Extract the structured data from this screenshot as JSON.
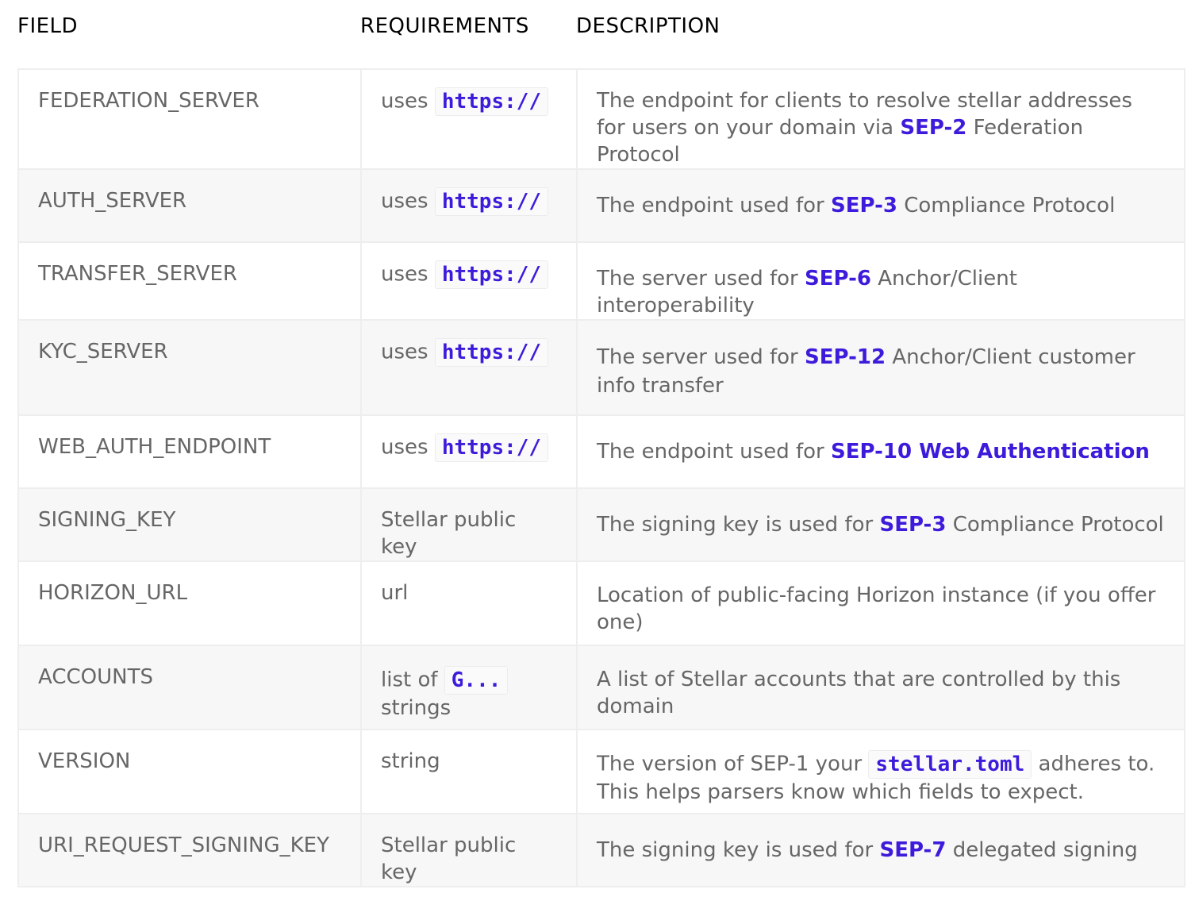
{
  "header": {
    "field": "FIELD",
    "requirements": "REQUIREMENTS",
    "description": "DESCRIPTION"
  },
  "rows": [
    {
      "field": "FEDERATION_SERVER",
      "req_prefix": "uses",
      "req_code": "https://",
      "desc_before": "The endpoint for clients to resolve stellar addresses for users on your domain via ",
      "desc_link": "SEP-2",
      "desc_after": " Federation Protocol"
    },
    {
      "field": "AUTH_SERVER",
      "req_prefix": "uses",
      "req_code": "https://",
      "desc_before": "The endpoint used for ",
      "desc_link": "SEP-3",
      "desc_after": " Compliance Protocol"
    },
    {
      "field": "TRANSFER_SERVER",
      "req_prefix": "uses",
      "req_code": "https://",
      "desc_before": "The server used for ",
      "desc_link": "SEP-6",
      "desc_after": " Anchor/Client interoperability"
    },
    {
      "field": "KYC_SERVER",
      "req_prefix": "uses",
      "req_code": "https://",
      "desc_before": "The server used for ",
      "desc_link": "SEP-12",
      "desc_after": " Anchor/Client customer info transfer"
    },
    {
      "field": "WEB_AUTH_ENDPOINT",
      "req_prefix": "uses",
      "req_code": "https://",
      "desc_before": "The endpoint used for ",
      "desc_link": "SEP-10 Web Authentication",
      "desc_after": ""
    },
    {
      "field": "SIGNING_KEY",
      "req_text": "Stellar public key",
      "desc_before": "The signing key is used for ",
      "desc_link": "SEP-3",
      "desc_after": " Compliance Protocol"
    },
    {
      "field": "HORIZON_URL",
      "req_text": "url",
      "desc_text": "Location of public-facing Horizon instance (if you offer one)"
    },
    {
      "field": "ACCOUNTS",
      "req_prefix": "list of",
      "req_code": "G...",
      "req_suffix": "strings",
      "desc_text": "A list of Stellar accounts that are controlled by this domain"
    },
    {
      "field": "VERSION",
      "req_text": "string",
      "desc_before": "The version of SEP-1 your ",
      "desc_code": "stellar.toml",
      "desc_after": " adheres to. This helps parsers know which fields to expect."
    },
    {
      "field": "URI_REQUEST_SIGNING_KEY",
      "req_text": "Stellar public key",
      "desc_before": "The signing key is used for ",
      "desc_link": "SEP-7",
      "desc_after": " delegated signing"
    }
  ]
}
